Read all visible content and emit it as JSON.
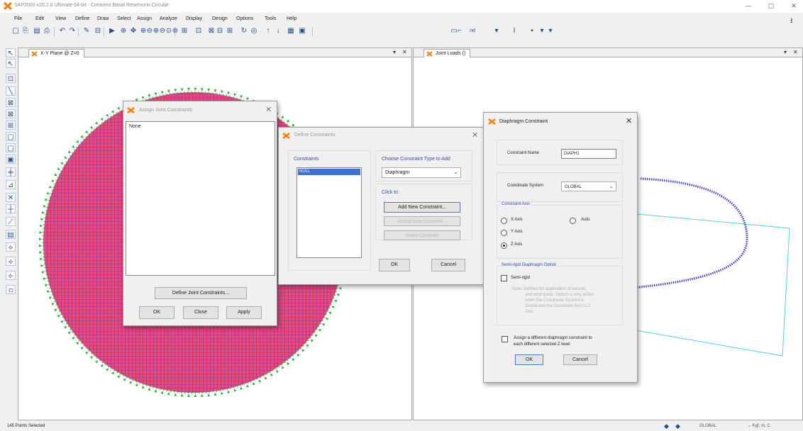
{
  "app": {
    "title": "SAP2000 v20.2.0 Ultimate 64-bit - Contorno Basal Reservorio Circular",
    "brand_color": "#ff7a00"
  },
  "menu": [
    "File",
    "Edit",
    "View",
    "Define",
    "Draw",
    "Select",
    "Assign",
    "Analyze",
    "Display",
    "Design",
    "Options",
    "Tools",
    "Help"
  ],
  "toolbar": {
    "dropdown_1": "nd",
    "dropdown_2": "I",
    "icons": [
      "new-icon",
      "open-icon",
      "save-icon",
      "print-icon",
      "undo-icon",
      "redo-icon",
      "pencil-icon",
      "lock-icon",
      "run-icon",
      "zoom-icon",
      "pan-icon",
      "3d-icon",
      "xy-icon",
      "xz-icon",
      "yz-icon",
      "nv-icon",
      "rotate-icon",
      "perspective-icon",
      "up-icon",
      "down-icon",
      "display-icon",
      "grid-icon"
    ]
  },
  "left_pane": {
    "tab_label": "X-Y Plane @ Z=0"
  },
  "right_pane": {
    "tab_label": "Joint Loads ()"
  },
  "assign_joint_constraints": {
    "title": "Assign Joint Constraints",
    "list_items": [
      "None"
    ],
    "define_button": "Define Joint Constraints...",
    "ok": "OK",
    "close": "Close",
    "apply": "Apply"
  },
  "define_constraints": {
    "title": "Define Constraints",
    "constraints_label": "Constraints",
    "constraints_items": [
      "NULL"
    ],
    "choose_label": "Choose Constraint Type to Add",
    "type_value": "Diaphragm",
    "click_to_label": "Click to:",
    "add_new": "Add New Constraint...",
    "modify_show": "Modify/Show Constraint...",
    "delete": "Delete Constraint",
    "ok": "OK",
    "cancel": "Cancel"
  },
  "diaphragm_constraint": {
    "title": "Diaphragm Constraint",
    "name_label": "Constraint Name",
    "name_value": "DIAPH1",
    "coord_label": "Coordinate System",
    "coord_value": "GLOBAL",
    "axis_group": "Constraint Axis",
    "x_axis": "X Axis",
    "y_axis": "Y Axis",
    "z_axis": "Z Axis",
    "auto": "Auto",
    "selected_axis": "Z Axis",
    "semirigid_group": "Semi-rigid Diaphragm Option",
    "semirigid_label": "Semi-rigid",
    "semirigid_checked": false,
    "note_lines": [
      "Note:  Defined for application of seismic",
      "and wind loads. Option is only active",
      "when the Coordinate System is",
      "Global and the Constraint Axis is Z",
      "Axis."
    ],
    "assign_diff_label_1": "Assign a different diaphragm constraint to",
    "assign_diff_label_2": "each different selected Z level",
    "assign_diff_checked": false,
    "ok": "OK",
    "cancel": "Cancel"
  },
  "status": {
    "selection": "145 Points Selected",
    "coord_system": "GLOBAL",
    "units": "Kgf, m, C"
  },
  "colors": {
    "mesh_fill": "#e8487a",
    "mesh_lines": "#3a2fb0",
    "support_green": "#2fae3a",
    "frame_cyan": "#4fd0e8",
    "ring_blue": "#3b3fd8"
  }
}
